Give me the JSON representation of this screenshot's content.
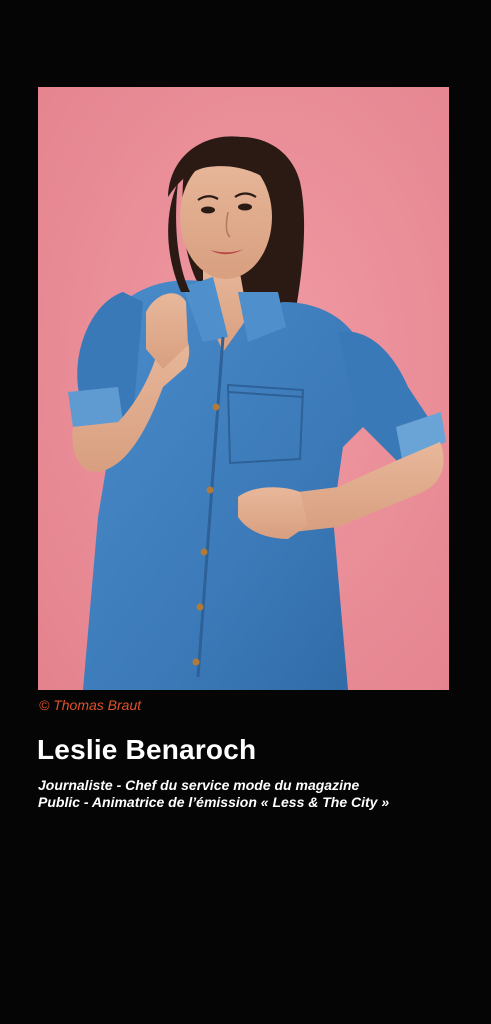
{
  "photo": {
    "icon": "portrait-photo",
    "background_color": "#e98c96",
    "shirt_color": "#3e7fbf"
  },
  "credit": "© Thomas Braut",
  "person": {
    "name": "Leslie Benaroch",
    "description_line1": "Journaliste - Chef du service mode du magazine",
    "description_line2": "Public - Animatrice de l’émission « Less & The City »"
  },
  "colors": {
    "page_background": "#050506",
    "credit_text": "#e0512a",
    "text": "#ffffff"
  }
}
